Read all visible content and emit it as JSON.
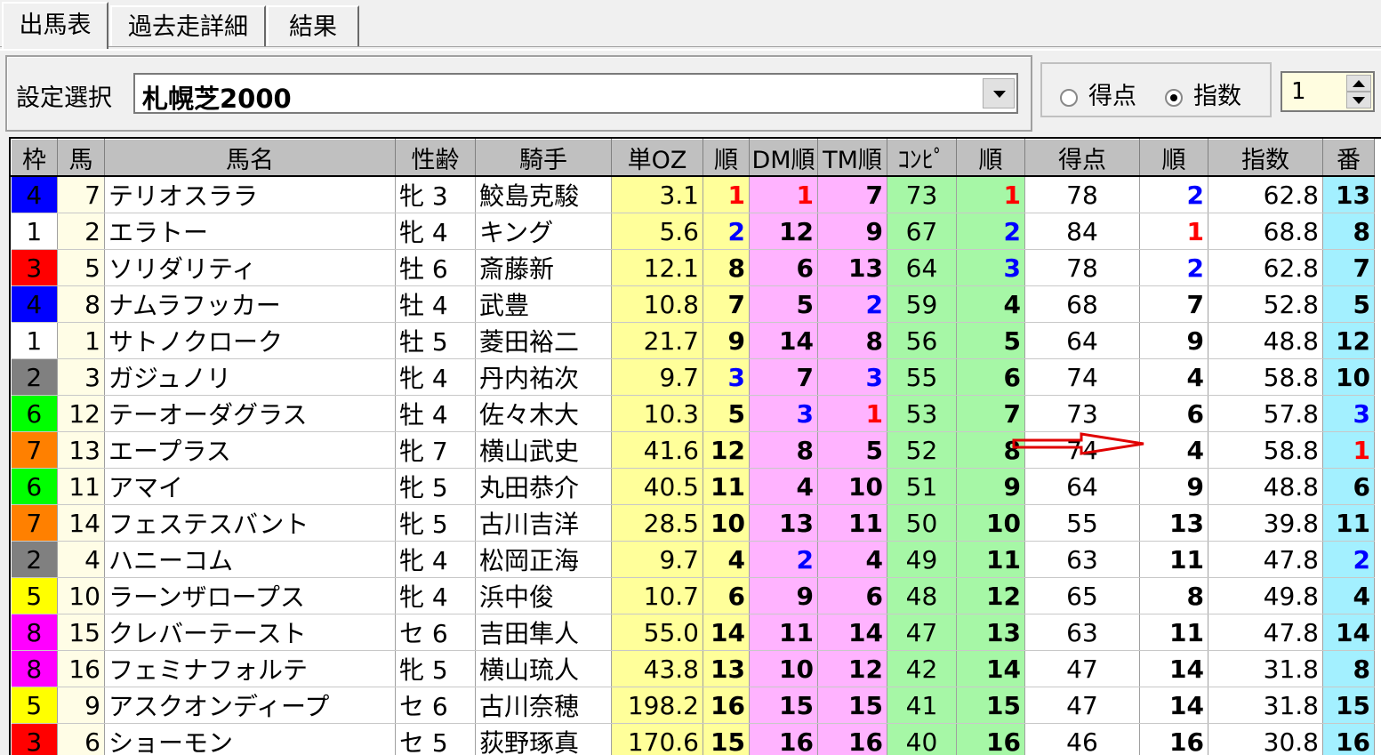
{
  "tabs": [
    {
      "label": "出馬表",
      "active": true
    },
    {
      "label": "過去走詳細",
      "active": false
    },
    {
      "label": "結果",
      "active": false
    }
  ],
  "settings": {
    "label": "設定選択",
    "course": "札幌芝2000",
    "radio_score": "得点",
    "radio_index": "指数",
    "selected": "指数",
    "spinner_value": "1"
  },
  "columns": [
    "枠",
    "馬",
    "馬名",
    "性齢",
    "騎手",
    "単OZ",
    "順",
    "DM順",
    "TM順",
    "ｺﾝﾋﾟ",
    "順",
    "得点",
    "順",
    "指数",
    "番"
  ],
  "rows": [
    {
      "waku": "4",
      "uma": "7",
      "name": "テリオスララ",
      "sex": "牝",
      "age": "3",
      "jockey": "鮫島克駿",
      "oz": "3.1",
      "oz_rank": "1",
      "dm": "1",
      "tm": "7",
      "compi": "73",
      "compi_rank": "1",
      "score": "78",
      "score_rank": "2",
      "index": "62.8",
      "index_rank": "13"
    },
    {
      "waku": "1",
      "uma": "2",
      "name": "エラトー",
      "sex": "牝",
      "age": "4",
      "jockey": "キング",
      "oz": "5.6",
      "oz_rank": "2",
      "dm": "12",
      "tm": "9",
      "compi": "67",
      "compi_rank": "2",
      "score": "84",
      "score_rank": "1",
      "index": "68.8",
      "index_rank": "8"
    },
    {
      "waku": "3",
      "uma": "5",
      "name": "ソリダリティ",
      "sex": "牡",
      "age": "6",
      "jockey": "斎藤新",
      "oz": "12.1",
      "oz_rank": "8",
      "dm": "6",
      "tm": "13",
      "compi": "64",
      "compi_rank": "3",
      "score": "78",
      "score_rank": "2",
      "index": "62.8",
      "index_rank": "7"
    },
    {
      "waku": "4",
      "uma": "8",
      "name": "ナムラフッカー",
      "sex": "牡",
      "age": "4",
      "jockey": "武豊",
      "oz": "10.8",
      "oz_rank": "7",
      "dm": "5",
      "tm": "2",
      "compi": "59",
      "compi_rank": "4",
      "score": "68",
      "score_rank": "7",
      "index": "52.8",
      "index_rank": "5"
    },
    {
      "waku": "1",
      "uma": "1",
      "name": "サトノクローク",
      "sex": "牡",
      "age": "5",
      "jockey": "菱田裕二",
      "oz": "21.7",
      "oz_rank": "9",
      "dm": "14",
      "tm": "8",
      "compi": "56",
      "compi_rank": "5",
      "score": "64",
      "score_rank": "9",
      "index": "48.8",
      "index_rank": "12"
    },
    {
      "waku": "2",
      "uma": "3",
      "name": "ガジュノリ",
      "sex": "牝",
      "age": "4",
      "jockey": "丹内祐次",
      "oz": "9.7",
      "oz_rank": "3",
      "dm": "7",
      "tm": "3",
      "compi": "55",
      "compi_rank": "6",
      "score": "74",
      "score_rank": "4",
      "index": "58.8",
      "index_rank": "10"
    },
    {
      "waku": "6",
      "uma": "12",
      "name": "テーオーダグラス",
      "sex": "牡",
      "age": "4",
      "jockey": "佐々木大",
      "oz": "10.3",
      "oz_rank": "5",
      "dm": "3",
      "tm": "1",
      "compi": "53",
      "compi_rank": "7",
      "score": "73",
      "score_rank": "6",
      "index": "57.8",
      "index_rank": "3"
    },
    {
      "waku": "7",
      "uma": "13",
      "name": "エープラス",
      "sex": "牝",
      "age": "7",
      "jockey": "横山武史",
      "oz": "41.6",
      "oz_rank": "12",
      "dm": "8",
      "tm": "5",
      "compi": "52",
      "compi_rank": "8",
      "score": "74",
      "score_rank": "4",
      "index": "58.8",
      "index_rank": "1"
    },
    {
      "waku": "6",
      "uma": "11",
      "name": "アマイ",
      "sex": "牝",
      "age": "5",
      "jockey": "丸田恭介",
      "oz": "40.5",
      "oz_rank": "11",
      "dm": "4",
      "tm": "10",
      "compi": "51",
      "compi_rank": "9",
      "score": "64",
      "score_rank": "9",
      "index": "48.8",
      "index_rank": "6"
    },
    {
      "waku": "7",
      "uma": "14",
      "name": "フェステスバント",
      "sex": "牝",
      "age": "5",
      "jockey": "古川吉洋",
      "oz": "28.5",
      "oz_rank": "10",
      "dm": "13",
      "tm": "11",
      "compi": "50",
      "compi_rank": "10",
      "score": "55",
      "score_rank": "13",
      "index": "39.8",
      "index_rank": "11"
    },
    {
      "waku": "2",
      "uma": "4",
      "name": "ハニーコム",
      "sex": "牝",
      "age": "4",
      "jockey": "松岡正海",
      "oz": "9.7",
      "oz_rank": "4",
      "dm": "2",
      "tm": "4",
      "compi": "49",
      "compi_rank": "11",
      "score": "63",
      "score_rank": "11",
      "index": "47.8",
      "index_rank": "2"
    },
    {
      "waku": "5",
      "uma": "10",
      "name": "ラーンザロープス",
      "sex": "牝",
      "age": "4",
      "jockey": "浜中俊",
      "oz": "10.7",
      "oz_rank": "6",
      "dm": "9",
      "tm": "6",
      "compi": "48",
      "compi_rank": "12",
      "score": "65",
      "score_rank": "8",
      "index": "49.8",
      "index_rank": "4"
    },
    {
      "waku": "8",
      "uma": "15",
      "name": "クレバーテースト",
      "sex": "セ",
      "age": "6",
      "jockey": "吉田隼人",
      "oz": "55.0",
      "oz_rank": "14",
      "dm": "11",
      "tm": "14",
      "compi": "47",
      "compi_rank": "13",
      "score": "63",
      "score_rank": "11",
      "index": "47.8",
      "index_rank": "14"
    },
    {
      "waku": "8",
      "uma": "16",
      "name": "フェミナフォルテ",
      "sex": "牝",
      "age": "5",
      "jockey": "横山琉人",
      "oz": "43.8",
      "oz_rank": "13",
      "dm": "10",
      "tm": "12",
      "compi": "42",
      "compi_rank": "14",
      "score": "47",
      "score_rank": "14",
      "index": "31.8",
      "index_rank": "8"
    },
    {
      "waku": "5",
      "uma": "9",
      "name": "アスクオンディープ",
      "sex": "セ",
      "age": "6",
      "jockey": "古川奈穂",
      "oz": "198.2",
      "oz_rank": "16",
      "dm": "15",
      "tm": "15",
      "compi": "41",
      "compi_rank": "15",
      "score": "47",
      "score_rank": "14",
      "index": "31.8",
      "index_rank": "15"
    },
    {
      "waku": "3",
      "uma": "6",
      "name": "ショーモン",
      "sex": "セ",
      "age": "5",
      "jockey": "荻野琢真",
      "oz": "170.6",
      "oz_rank": "15",
      "dm": "16",
      "tm": "16",
      "compi": "40",
      "compi_rank": "16",
      "score": "46",
      "score_rank": "16",
      "index": "30.8",
      "index_rank": "16"
    }
  ],
  "colors": {
    "waku": {
      "1": "#ffffff",
      "2": "#808080",
      "3": "#ff0000",
      "4": "#0000ff",
      "5": "#ffff00",
      "6": "#00ff00",
      "7": "#ff8000",
      "8": "#ff00ff"
    },
    "rank1": "#ff0000",
    "rank2_3": "#0000ff",
    "arrow": "#e00000"
  }
}
